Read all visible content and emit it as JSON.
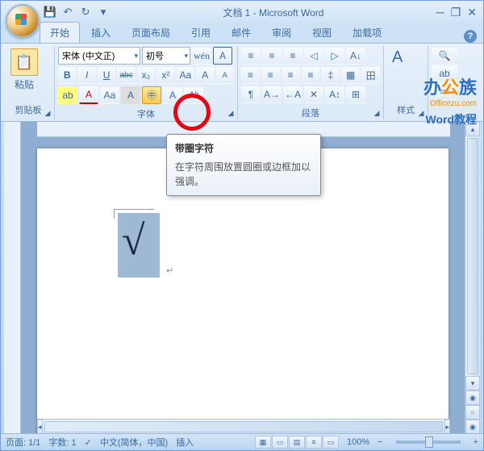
{
  "titlebar": {
    "title": "文档 1 - Microsoft Word"
  },
  "qat": {
    "save": "💾",
    "undo": "↶",
    "redo": "↻",
    "more": "▾"
  },
  "win": {
    "min": "─",
    "max": "❐",
    "close": "✕"
  },
  "tabs": {
    "items": [
      {
        "label": "开始",
        "active": true
      },
      {
        "label": "插入"
      },
      {
        "label": "页面布局"
      },
      {
        "label": "引用"
      },
      {
        "label": "邮件"
      },
      {
        "label": "审阅"
      },
      {
        "label": "视图"
      },
      {
        "label": "加载项"
      }
    ],
    "help": "?"
  },
  "ribbon": {
    "clipboard": {
      "label": "剪贴板",
      "paste": "粘贴",
      "paste_icon": "📋"
    },
    "font": {
      "label": "字体",
      "family": "宋体 (中文正)",
      "size": "初号",
      "grow": "A",
      "shrink": "A",
      "clear": "Aᵇ",
      "bold": "B",
      "italic": "I",
      "underline": "U",
      "strike": "abc",
      "sub": "x₂",
      "sup": "x²",
      "case": "Aa",
      "highlight": "ab",
      "color": "A",
      "aa": "Aa",
      "char_border": "A",
      "enclosed": "㊥",
      "phonetic": "A",
      "box": "A"
    },
    "para": {
      "label": "段落",
      "bullets": "≡",
      "numbers": "≡",
      "multilevel": "≡",
      "dedent": "◁",
      "indent": "▷",
      "sort": "A↓",
      "left": "≡",
      "center": "≡",
      "right": "≡",
      "justify": "≡",
      "spacing": "‡",
      "shading": "▦",
      "border": "田",
      "show": "¶",
      "ltr": "A→",
      "rtl": "←A"
    },
    "styles": {
      "label": "样式",
      "change": "A"
    },
    "editing": {
      "find": "🔍",
      "replace": "ab",
      "select": "▭"
    }
  },
  "tooltip": {
    "title": "带圈字符",
    "body": "在字符周围放置圆圈或边框加以强调。"
  },
  "doc": {
    "checkmark": "√",
    "pmark": "↵"
  },
  "status": {
    "page": "页面: 1/1",
    "words": "字数: 1",
    "proof": "✓",
    "lang": "中文(简体，中国)",
    "insert": "插入",
    "zoom": "100%",
    "minus": "−",
    "plus": "+"
  },
  "watermark": {
    "t1a": "办",
    "t1b": "公",
    "t1c": "族",
    "t2": "Officezu.com",
    "t3": "Word教程"
  }
}
